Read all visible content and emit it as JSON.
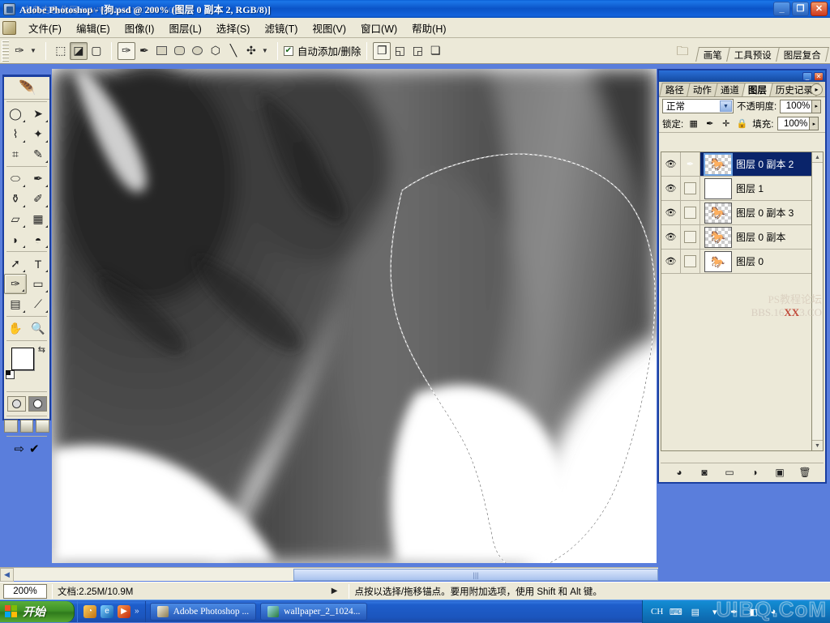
{
  "window": {
    "title": "Adobe Photoshop - [狗.psd @ 200% (图层 0 副本 2, RGB/8)]",
    "watermark": "古典古色化网 WWW.MISSYUAN.COM",
    "minimize": "_",
    "restore": "❐",
    "close": "✕"
  },
  "menubar": {
    "items": [
      {
        "label": "文件(F)"
      },
      {
        "label": "编辑(E)"
      },
      {
        "label": "图像(I)"
      },
      {
        "label": "图层(L)"
      },
      {
        "label": "选择(S)"
      },
      {
        "label": "滤镜(T)"
      },
      {
        "label": "视图(V)"
      },
      {
        "label": "窗口(W)"
      },
      {
        "label": "帮助(H)"
      }
    ]
  },
  "optionsbar": {
    "active_tool_icon": "pen-tool-icon",
    "mode_buttons": [
      "shape-layers-icon",
      "paths-icon",
      "fill-pixels-icon"
    ],
    "shape_tools": [
      "pen-tool-icon",
      "freeform-pen-icon",
      "rectangle-icon",
      "rounded-rect-icon",
      "ellipse-icon",
      "polygon-icon",
      "line-icon",
      "custom-shape-icon"
    ],
    "auto_add_delete": {
      "label": "自动添加/删除",
      "checked": "✔"
    },
    "path_ops": [
      "add-to-area-icon",
      "subtract-area-icon",
      "intersect-area-icon",
      "exclude-area-icon"
    ],
    "dock_icon": "file-browser-icon",
    "palette_tabs": [
      {
        "label": "画笔"
      },
      {
        "label": "工具预设"
      },
      {
        "label": "图层复合"
      }
    ]
  },
  "toolbox": {
    "tools": [
      {
        "name": "marquee-elliptical-tool",
        "glyph": "◯"
      },
      {
        "name": "move-tool",
        "glyph": "➤"
      },
      {
        "name": "lasso-tool",
        "glyph": "⌇"
      },
      {
        "name": "magic-wand-tool",
        "glyph": "✦"
      },
      {
        "name": "crop-tool",
        "glyph": "⌗"
      },
      {
        "name": "slice-tool",
        "glyph": "✎"
      },
      {
        "name": "healing-brush-tool",
        "glyph": "⬭"
      },
      {
        "name": "brush-tool",
        "glyph": "✒"
      },
      {
        "name": "clone-stamp-tool",
        "glyph": "⚱"
      },
      {
        "name": "history-brush-tool",
        "glyph": "✐"
      },
      {
        "name": "eraser-tool",
        "glyph": "▱"
      },
      {
        "name": "gradient-tool",
        "glyph": "▦"
      },
      {
        "name": "blur-tool",
        "glyph": "💧"
      },
      {
        "name": "dodge-tool",
        "glyph": "◓"
      },
      {
        "name": "path-selection-tool",
        "glyph": "➚"
      },
      {
        "name": "type-tool",
        "glyph": "T"
      },
      {
        "name": "pen-tool",
        "glyph": "✑",
        "selected": true
      },
      {
        "name": "rounded-rectangle-tool",
        "glyph": "▭"
      },
      {
        "name": "notes-tool",
        "glyph": "▤"
      },
      {
        "name": "eyedropper-tool",
        "glyph": "✒"
      },
      {
        "name": "hand-tool",
        "glyph": "✋"
      },
      {
        "name": "zoom-tool",
        "glyph": "🔍"
      }
    ],
    "colors": {
      "foreground": "#ffffff",
      "background": "#808080",
      "swap_icon": "swap-colors-icon",
      "default_icon": "default-colors-icon"
    },
    "quickmask": [
      "standard-mode-icon",
      "quickmask-mode-icon"
    ],
    "screenmodes": [
      "standard-screen-icon",
      "fullscreen-menubar-icon",
      "fullscreen-icon"
    ],
    "jump": [
      "jump-to-imageready-icon",
      "edit-in-imageready-icon"
    ]
  },
  "layers_palette": {
    "tabs": [
      {
        "label": "路径",
        "active": false
      },
      {
        "label": "动作",
        "active": false
      },
      {
        "label": "通道",
        "active": false
      },
      {
        "label": "图层",
        "active": true
      },
      {
        "label": "历史记录",
        "active": false
      }
    ],
    "menu_icon": "palette-menu-icon",
    "blend_mode": "正常",
    "opacity_label": "不透明度:",
    "opacity_value": "100%",
    "lock_label": "锁定:",
    "lock_icons": [
      "lock-transparent-icon",
      "lock-image-icon",
      "lock-position-icon",
      "lock-all-icon"
    ],
    "fill_label": "填充:",
    "fill_value": "100%",
    "layers": [
      {
        "name": "图层 0 副本 2",
        "visible": "👁",
        "selected": true,
        "has_link": true,
        "thumb": "horse-transparent"
      },
      {
        "name": "图层 1",
        "visible": "👁",
        "selected": false,
        "has_link": false,
        "thumb": "white"
      },
      {
        "name": "图层 0 副本 3",
        "visible": "👁",
        "selected": false,
        "has_link": false,
        "thumb": "horse-transparent"
      },
      {
        "name": "图层 0 副本",
        "visible": "👁",
        "selected": false,
        "has_link": false,
        "thumb": "horse-transparent"
      },
      {
        "name": "图层 0",
        "visible": "👁",
        "selected": false,
        "has_link": false,
        "thumb": "horse-white"
      }
    ],
    "watermark_line1": "PS教程论坛",
    "watermark_line2_a": "BBS.16",
    "watermark_line2_b": "XX",
    "watermark_line2_c": "3.CO",
    "bottom_buttons": [
      {
        "name": "layer-style-button",
        "glyph": "◕"
      },
      {
        "name": "layer-mask-button",
        "glyph": "◙"
      },
      {
        "name": "new-group-button",
        "glyph": "▭"
      },
      {
        "name": "adjustment-layer-button",
        "glyph": "◑"
      },
      {
        "name": "new-layer-button",
        "glyph": "▣"
      },
      {
        "name": "delete-layer-button",
        "glyph": "🗑"
      }
    ],
    "close_button": "✕",
    "minimize_button": "_"
  },
  "statusbar": {
    "zoom": "200%",
    "doc_label": "文档:2.25M/10.9M",
    "expand_arrow": "▶",
    "hint": "点按以选择/拖移锚点。要用附加选项，使用 Shift 和 Alt 键。"
  },
  "taskbar": {
    "start_label": "开始",
    "quicklaunch": [
      "show-desktop-icon",
      "internet-explorer-icon",
      "media-player-icon"
    ],
    "quicklaunch_more": "»",
    "buttons": [
      {
        "label": "Adobe Photoshop ...",
        "icon": "photoshop-icon"
      },
      {
        "label": "wallpaper_2_1024...",
        "icon": "image-viewer-icon"
      }
    ],
    "tray": {
      "language": "CH",
      "icons": [
        "keyboard-icon",
        "ime-toolbar-icon",
        "chevron-down-icon"
      ],
      "watermark": "UIBQ.CoM"
    }
  },
  "scrollbar": {
    "left_arrow": "◀",
    "thumb_grip": "|||"
  }
}
